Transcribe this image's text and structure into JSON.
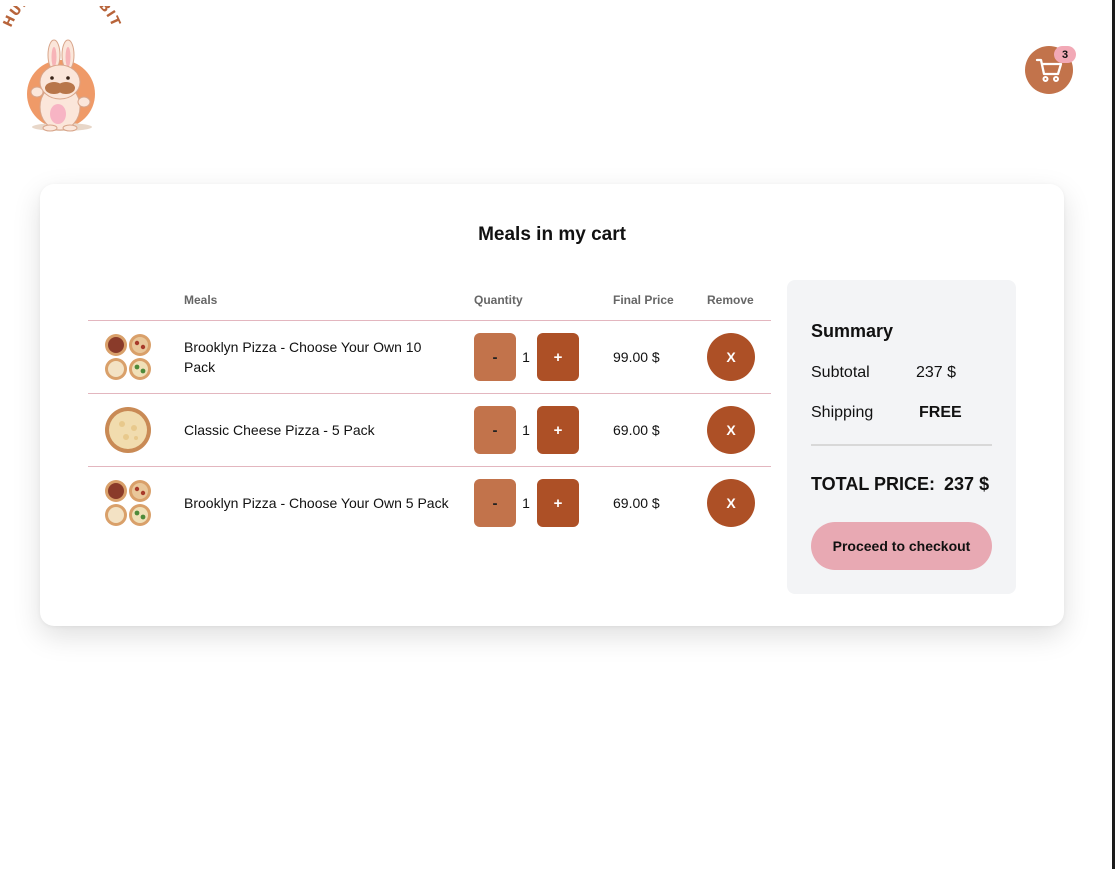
{
  "brand": {
    "logo_text": "HUNGRY RABBIT"
  },
  "header": {
    "cart_count": "3",
    "cart_icon": "shopping-cart-icon"
  },
  "cart": {
    "title": "Meals in my cart",
    "columns": {
      "image": "",
      "meals": "Meals",
      "quantity": "Quantity",
      "final_price": "Final Price",
      "remove": "Remove"
    },
    "items": [
      {
        "name": "Brooklyn Pizza - Choose Your Own 10 Pack",
        "quantity": "1",
        "price": "99.00 $",
        "image": "pizza-four-pack-image",
        "minus_label": "-",
        "plus_label": "+",
        "remove_label": "X"
      },
      {
        "name": "Classic Cheese Pizza - 5 Pack",
        "quantity": "1",
        "price": "69.00 $",
        "image": "cheese-pizza-image",
        "minus_label": "-",
        "plus_label": "+",
        "remove_label": "X"
      },
      {
        "name": "Brooklyn Pizza - Choose Your Own 5 Pack",
        "quantity": "1",
        "price": "69.00 $",
        "image": "pizza-four-pack-image",
        "minus_label": "-",
        "plus_label": "+",
        "remove_label": "X"
      }
    ]
  },
  "summary": {
    "title": "Summary",
    "subtotal_label": "Subtotal",
    "subtotal_value": "237 $",
    "shipping_label": "Shipping",
    "shipping_value": "FREE",
    "total_label": "TOTAL PRICE:",
    "total_value": "237 $",
    "checkout_label": "Proceed to checkout"
  },
  "colors": {
    "accent_brown": "#ad5026",
    "accent_light_brown": "#c2734b",
    "accent_pink": "#e8a9b3",
    "summary_bg": "#f3f4f6"
  }
}
